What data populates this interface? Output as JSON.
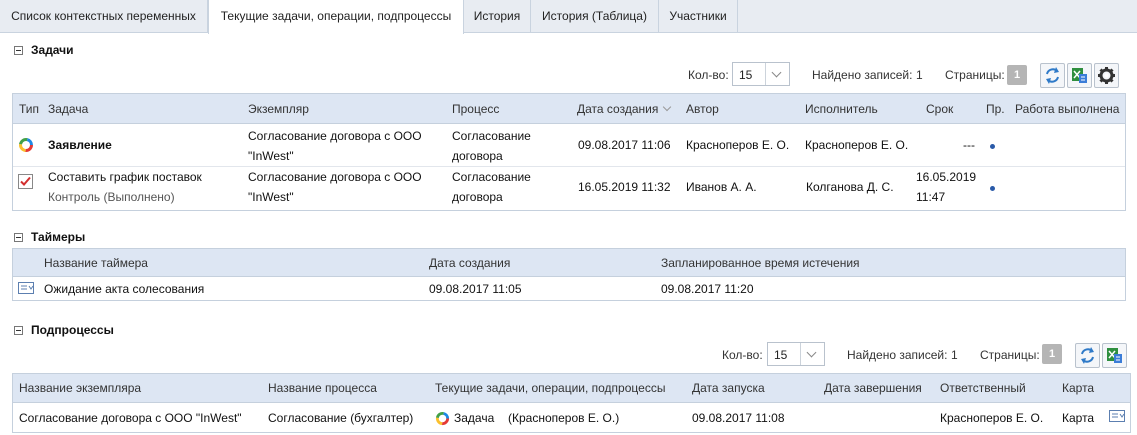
{
  "tabs": [
    {
      "label": "Список контекстных переменных"
    },
    {
      "label": "Текущие задачи, операции, подпроцессы"
    },
    {
      "label": "История"
    },
    {
      "label": "История (Таблица)"
    },
    {
      "label": "Участники"
    }
  ],
  "tasks": {
    "title": "Задачи",
    "toolbar": {
      "count_label": "Кол-во:",
      "count_value": "15",
      "found_label": "Найдено записей:",
      "found_value": "1",
      "pages_label": "Страницы:",
      "page": "1"
    },
    "columns": {
      "type": "Тип",
      "task": "Задача",
      "instance": "Экземпляр",
      "process": "Процесс",
      "created": "Дата создания",
      "author": "Автор",
      "executor": "Исполнитель",
      "due": "Срок",
      "priority": "Пр.",
      "done": "Работа выполнена"
    },
    "rows": [
      {
        "icon": "process-ring-icon",
        "task": "Заявление",
        "task_sub": "",
        "instance_1": "Согласование договора с ООО",
        "instance_2": "\"InWest\"",
        "process_1": "Согласование",
        "process_2": "договора",
        "created": "09.08.2017 11:06",
        "author": "Красноперов Е. О.",
        "executor": "Красноперов Е. О.",
        "due_1": "---",
        "due_2": ""
      },
      {
        "icon": "checkbox-checked-icon",
        "task": "Составить график поставок",
        "task_sub": "Контроль (Выполнено)",
        "instance_1": "Согласование договора с ООО",
        "instance_2": "\"InWest\"",
        "process_1": "Согласование",
        "process_2": "договора",
        "created": "16.05.2019 11:32",
        "author": "Иванов А. А.",
        "executor": "Колганова Д. С.",
        "due_1": "16.05.2019",
        "due_2": "11:47"
      }
    ]
  },
  "timers": {
    "title": "Таймеры",
    "columns": {
      "name": "Название таймера",
      "created": "Дата создания",
      "scheduled": "Запланированное время истечения"
    },
    "rows": [
      {
        "name": "Ожидание акта солесования",
        "created": "09.08.2017 11:05",
        "scheduled": "09.08.2017 11:20"
      }
    ]
  },
  "subprocesses": {
    "title": "Подпроцессы",
    "toolbar": {
      "count_label": "Кол-во:",
      "count_value": "15",
      "found_label": "Найдено записей:",
      "found_value": "1",
      "pages_label": "Страницы:",
      "page": "1"
    },
    "columns": {
      "instance": "Название экземпляра",
      "process": "Название процесса",
      "current": "Текущие задачи, операции, подпроцессы",
      "started": "Дата запуска",
      "finished": "Дата завершения",
      "responsible": "Ответственный",
      "map": "Карта"
    },
    "rows": [
      {
        "instance": "Согласование договора с ООО \"InWest\"",
        "process": "Согласование (бухгалтер)",
        "task_link": "Задача",
        "task_person": "(Красноперов Е. О.)",
        "started": "09.08.2017 11:08",
        "finished": "",
        "responsible": "Красноперов Е. О.",
        "map": "Карта"
      }
    ]
  },
  "colors": {
    "accent": "#2a5aa8",
    "header_bg": "#dde6f3",
    "tabbar_bg": "#e8ecf2"
  }
}
